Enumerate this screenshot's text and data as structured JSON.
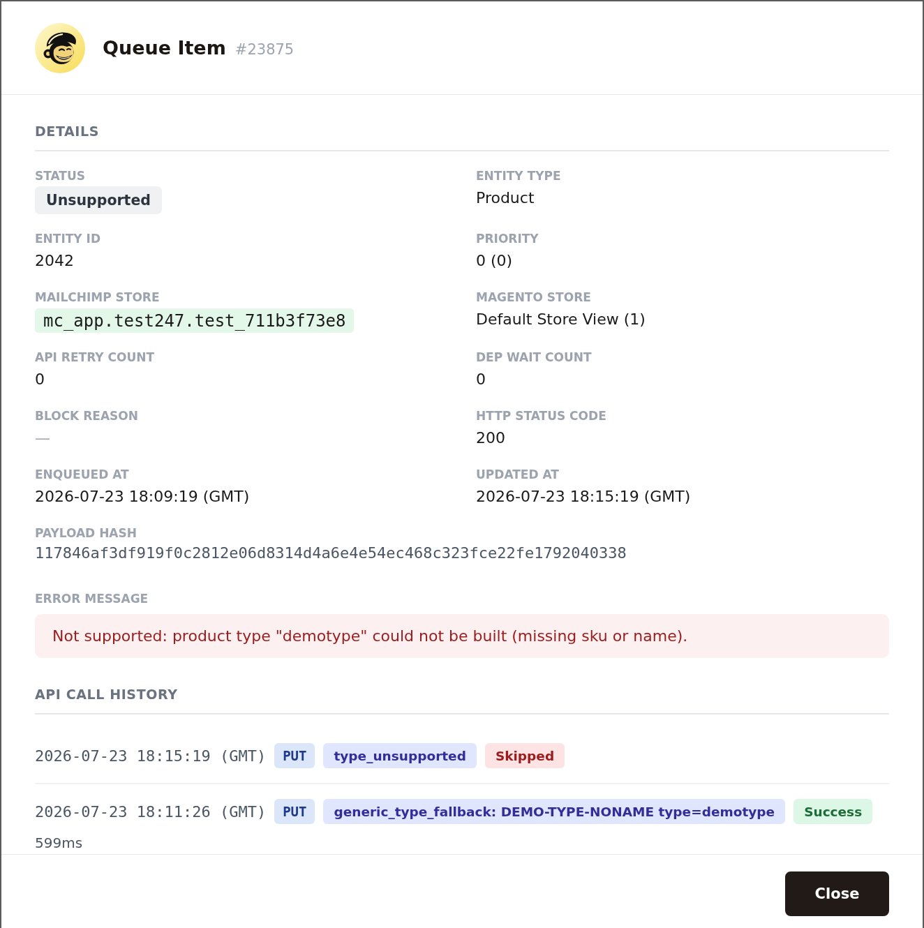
{
  "header": {
    "title": "Queue Item",
    "item_number": "#23875"
  },
  "details": {
    "heading": "DETAILS",
    "fields": [
      {
        "label": "STATUS",
        "value": "Unsupported",
        "kind": "status"
      },
      {
        "label": "ENTITY TYPE",
        "value": "Product",
        "kind": "text"
      },
      {
        "label": "ENTITY ID",
        "value": "2042",
        "kind": "text"
      },
      {
        "label": "PRIORITY",
        "value": "0 (0)",
        "kind": "text"
      },
      {
        "label": "MAILCHIMP STORE",
        "value": "mc_app.test247.test_711b3f73e8",
        "kind": "code"
      },
      {
        "label": "MAGENTO STORE",
        "value": "Default Store View (1)",
        "kind": "text"
      },
      {
        "label": "API RETRY COUNT",
        "value": "0",
        "kind": "text"
      },
      {
        "label": "DEP WAIT COUNT",
        "value": "0",
        "kind": "text"
      },
      {
        "label": "BLOCK REASON",
        "value": "—",
        "kind": "empty"
      },
      {
        "label": "HTTP STATUS CODE",
        "value": "200",
        "kind": "text"
      },
      {
        "label": "ENQUEUED AT",
        "value": "2026-07-23 18:09:19 (GMT)",
        "kind": "text"
      },
      {
        "label": "UPDATED AT",
        "value": "2026-07-23 18:15:19 (GMT)",
        "kind": "text"
      },
      {
        "label": "PAYLOAD HASH",
        "value": "117846af3df919f0c2812e06d8314d4a6e4e54ec468c323fce22fe1792040338",
        "kind": "hash"
      },
      {
        "label": "ERROR MESSAGE",
        "value": "Not supported: product type \"demotype\" could not be built (missing sku or name).",
        "kind": "error"
      }
    ]
  },
  "api_call_history": {
    "heading": "API CALL HISTORY",
    "calls": [
      {
        "time": "2026-07-23 18:15:19 (GMT)",
        "method": "PUT",
        "note": "type_unsupported",
        "result": "Skipped",
        "kind": "skipped"
      },
      {
        "time": "2026-07-23 18:11:26 (GMT)",
        "method": "PUT",
        "note": "generic_type_fallback: DEMO-TYPE-NONAME type=demotype",
        "result": "Success",
        "kind": "success",
        "duration": "599ms"
      }
    ]
  },
  "footer": {
    "close_button": "Close"
  }
}
